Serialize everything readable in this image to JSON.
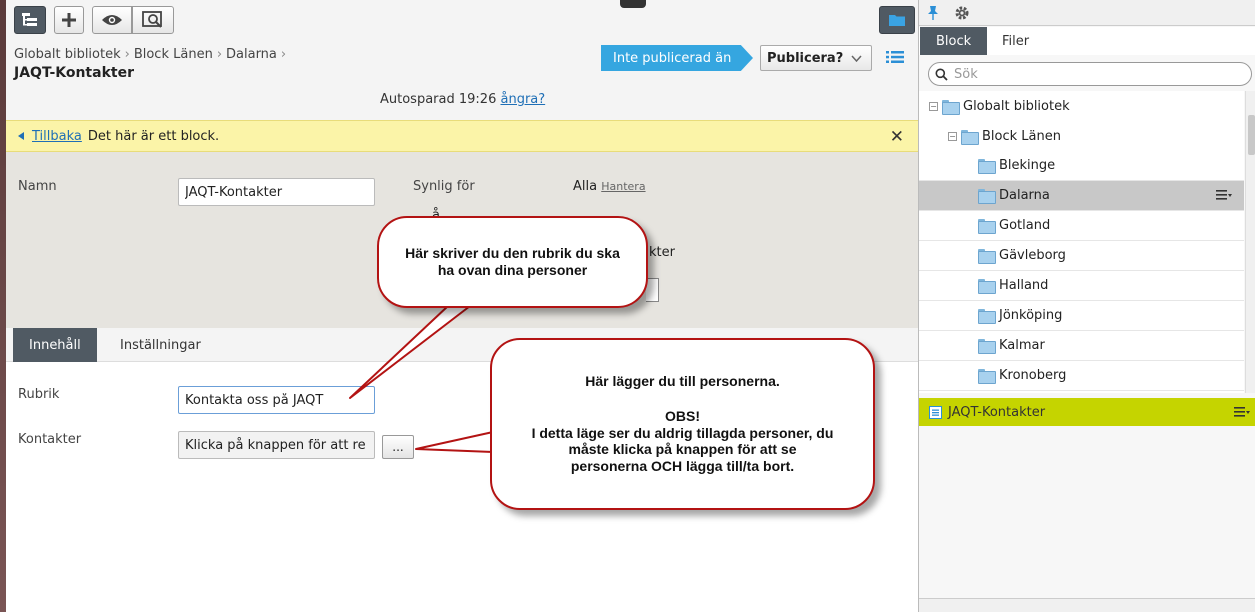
{
  "toolbar": {
    "buttons": [
      "tree-icon",
      "plus-icon",
      "eye-icon",
      "preview-icon"
    ],
    "folder_button_icon": "folder-icon"
  },
  "breadcrumb": [
    "Globalt bibliotek",
    "Block Länen",
    "Dalarna"
  ],
  "page_title": "JAQT-Kontakter",
  "status_label": "Inte publicerad än",
  "publish_label": "Publicera?",
  "autosave": {
    "text": "Autosparad 19:26",
    "undo_label": "ångra?"
  },
  "notice": {
    "back_label": "Tillbaka",
    "message": "Det här är ett block.",
    "close_glyph": "✕"
  },
  "properties": {
    "name_label": "Namn",
    "name_value": "JAQT-Kontakter",
    "visible_label": "Synlig för",
    "visible_value": "Alla",
    "manage_label": "Hantera",
    "fragment_accent": "å",
    "fragment_text": "akter"
  },
  "tabs": [
    "Innehåll",
    "Inställningar"
  ],
  "content": {
    "heading_label": "Rubrik",
    "heading_value": "Kontakta oss på JAQT",
    "contacts_label": "Kontakter",
    "contacts_value": "Klicka på knappen för att re",
    "ellipsis_label": "..."
  },
  "callouts": {
    "one": [
      "Här skriver du den rubrik du ska",
      "ha ovan dina personer"
    ],
    "two": [
      "Här lägger du till personerna.",
      "",
      "OBS!",
      "I detta läge ser du aldrig tillagda personer, du",
      "måste klicka på knappen för att se",
      "personerna OCH lägga till/ta bort."
    ]
  },
  "side": {
    "top_icons": [
      "pin-icon",
      "gear-icon"
    ],
    "tabs": [
      "Block",
      "Filer"
    ],
    "search_placeholder": "Sök",
    "tree_root": "Globalt bibliotek",
    "tree_group": "Block Länen",
    "tree_items": [
      "Blekinge",
      "Dalarna",
      "Gotland",
      "Gävleborg",
      "Halland",
      "Jönköping",
      "Kalmar",
      "Kronoberg"
    ],
    "selected_item": "Dalarna",
    "selected_block": "JAQT-Kontakter"
  },
  "colors": {
    "status": "#35a6e0",
    "accent_dark": "#505a63",
    "notice_bg": "#fbf4a8",
    "selected_bar": "#c5d400",
    "callout_border": "#b31313"
  }
}
